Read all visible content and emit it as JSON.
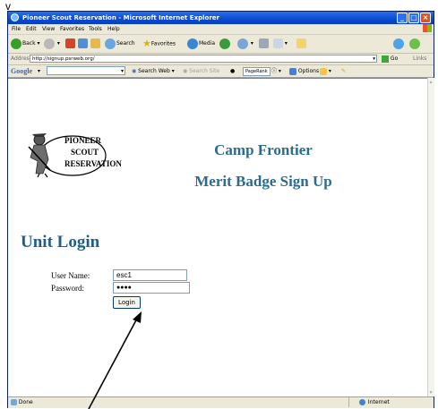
{
  "annotation_letter": "v",
  "window": {
    "title": "Pioneer Scout Reservation - Microsoft Internet Explorer",
    "controls": {
      "minimize": "_",
      "maximize": "□",
      "close": "×"
    }
  },
  "menu": [
    "File",
    "Edit",
    "View",
    "Favorites",
    "Tools",
    "Help"
  ],
  "toolbar": {
    "back": "Back",
    "search": "Search",
    "favorites": "Favorites",
    "media": "Media"
  },
  "address": {
    "label": "Address",
    "url": "http://signup.psrweb.org/",
    "go": "Go",
    "links": "Links"
  },
  "google_toolbar": {
    "brand": "Google",
    "search_web": "Search Web",
    "search_site": "Search Site",
    "pagerank": "PageRank",
    "options": "Options"
  },
  "page": {
    "logo_text": [
      "PIONEER",
      "SCOUT",
      "RESERVATION"
    ],
    "title": "Camp Frontier",
    "subtitle": "Merit Badge Sign Up",
    "section_heading": "Unit Login",
    "username_label": "User Name:",
    "username_value": "esc1",
    "password_label": "Password:",
    "password_value": "●●●●",
    "login_button": "Login"
  },
  "status": {
    "left": "Done",
    "zone": "Internet"
  },
  "colors": {
    "heading": "#2b6b8e",
    "titlebar": "#0a4ad6"
  }
}
